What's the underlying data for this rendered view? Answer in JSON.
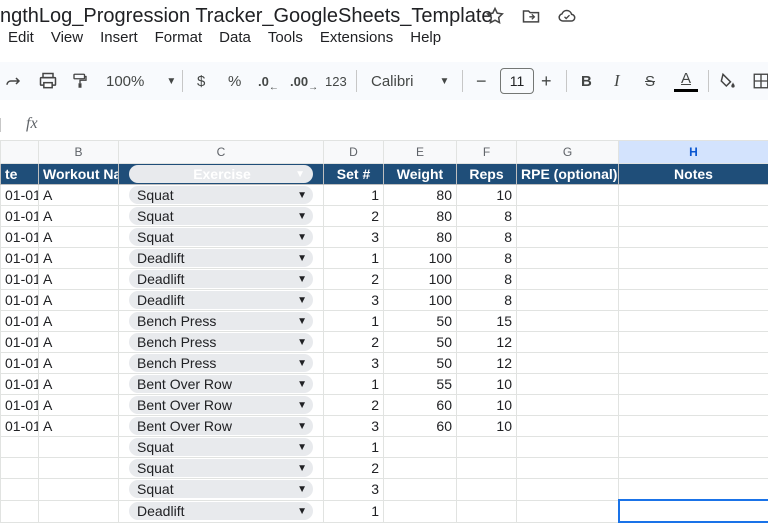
{
  "doc": {
    "title": "ngthLog_Progression Tracker_GoogleSheets_Template"
  },
  "menu": [
    "Edit",
    "View",
    "Insert",
    "Format",
    "Data",
    "Tools",
    "Extensions",
    "Help"
  ],
  "toolbar": {
    "zoom": "100%",
    "currency": "$",
    "percent": "%",
    "dec_less": ".0",
    "dec_more": ".00",
    "number_format": "123",
    "font": "Calibri",
    "font_size": "11",
    "minus": "−",
    "plus": "+",
    "bold": "B",
    "italic": "I",
    "strike": "S",
    "text_color": "A"
  },
  "formula": {
    "fx": "fx"
  },
  "columns": [
    "",
    "B",
    "C",
    "D",
    "E",
    "F",
    "G",
    "H"
  ],
  "headers": [
    "te",
    "Workout Nam",
    "Exercise",
    "Set #",
    "Weight",
    "Reps",
    "RPE (optional)",
    "Notes"
  ],
  "rows": [
    {
      "date": "01-01",
      "workout": "A",
      "exercise": "Squat",
      "set": "1",
      "weight": "80",
      "reps": "10"
    },
    {
      "date": "01-01",
      "workout": "A",
      "exercise": "Squat",
      "set": "2",
      "weight": "80",
      "reps": "8"
    },
    {
      "date": "01-01",
      "workout": "A",
      "exercise": "Squat",
      "set": "3",
      "weight": "80",
      "reps": "8"
    },
    {
      "date": "01-01",
      "workout": "A",
      "exercise": "Deadlift",
      "set": "1",
      "weight": "100",
      "reps": "8"
    },
    {
      "date": "01-01",
      "workout": "A",
      "exercise": "Deadlift",
      "set": "2",
      "weight": "100",
      "reps": "8"
    },
    {
      "date": "01-01",
      "workout": "A",
      "exercise": "Deadlift",
      "set": "3",
      "weight": "100",
      "reps": "8"
    },
    {
      "date": "01-01",
      "workout": "A",
      "exercise": "Bench Press",
      "set": "1",
      "weight": "50",
      "reps": "15"
    },
    {
      "date": "01-01",
      "workout": "A",
      "exercise": "Bench Press",
      "set": "2",
      "weight": "50",
      "reps": "12"
    },
    {
      "date": "01-01",
      "workout": "A",
      "exercise": "Bench Press",
      "set": "3",
      "weight": "50",
      "reps": "12"
    },
    {
      "date": "01-01",
      "workout": "A",
      "exercise": "Bent Over Row",
      "set": "1",
      "weight": "55",
      "reps": "10"
    },
    {
      "date": "01-01",
      "workout": "A",
      "exercise": "Bent Over Row",
      "set": "2",
      "weight": "60",
      "reps": "10"
    },
    {
      "date": "01-01",
      "workout": "A",
      "exercise": "Bent Over Row",
      "set": "3",
      "weight": "60",
      "reps": "10"
    },
    {
      "date": "",
      "workout": "",
      "exercise": "Squat",
      "set": "1",
      "weight": "",
      "reps": ""
    },
    {
      "date": "",
      "workout": "",
      "exercise": "Squat",
      "set": "2",
      "weight": "",
      "reps": ""
    },
    {
      "date": "",
      "workout": "",
      "exercise": "Squat",
      "set": "3",
      "weight": "",
      "reps": ""
    },
    {
      "date": "",
      "workout": "",
      "exercise": "Deadlift",
      "set": "1",
      "weight": "",
      "reps": ""
    }
  ],
  "colors": {
    "header_bg": "#1f4e79",
    "chip_bg": "#e8eaed",
    "selected_col": "#d3e3fd",
    "accent": "#1a73e8"
  }
}
